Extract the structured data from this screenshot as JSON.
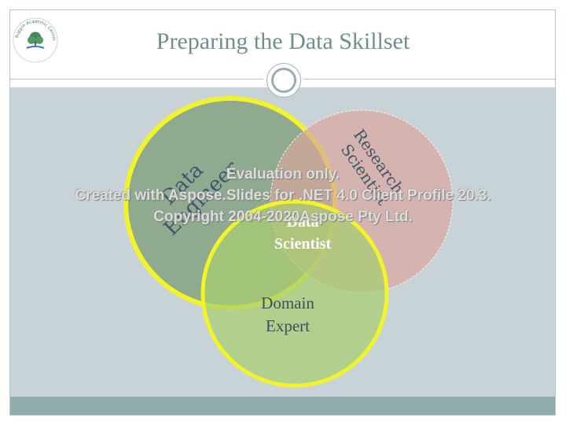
{
  "slide": {
    "title": "Preparing the Data Skillset"
  },
  "logo": {
    "icon": "tree-logo-icon",
    "text_outer": "רופין המרכז האקדמי",
    "text_inner": "Ruppin Academic Center"
  },
  "venn": {
    "data_engineer": "Data Engineer",
    "research_scientist": "Research Scientist",
    "data_scientist_line1": "Data",
    "data_scientist_line2": "Scientist",
    "domain_expert_line1": "Domain",
    "domain_expert_line2": "Expert"
  },
  "watermark": {
    "line1": "Evaluation only.",
    "line2": "Created with Aspose.Slides for .NET 4.0 Client Profile 20.3.",
    "line3": "Copyright 2004-2020Aspose Pty Ltd."
  },
  "colors": {
    "accent_yellow": "#f3f32a",
    "title_teal": "#6f8f8d",
    "content_bg": "#c8d3d8",
    "footer_bg": "#8fadac"
  }
}
